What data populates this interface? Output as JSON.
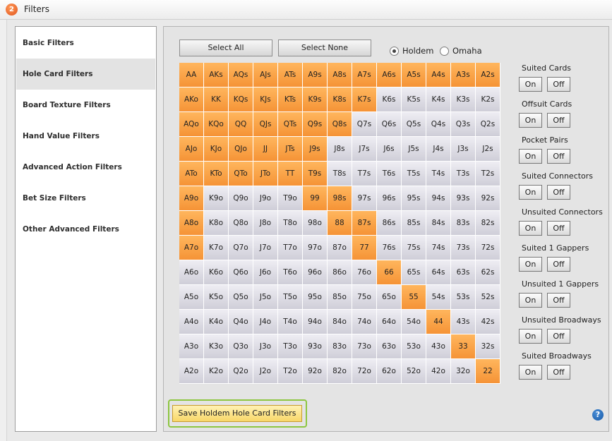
{
  "window": {
    "title": "Filters",
    "icon": "app-logo-icon"
  },
  "nav": {
    "items": [
      {
        "label": "Basic Filters"
      },
      {
        "label": "Hole Card Filters",
        "selected": true
      },
      {
        "label": "Board Texture Filters"
      },
      {
        "label": "Hand Value Filters"
      },
      {
        "label": "Advanced Action Filters"
      },
      {
        "label": "Bet Size Filters"
      },
      {
        "label": "Other Advanced Filters"
      }
    ]
  },
  "toolbar": {
    "select_all": "Select All",
    "select_none": "Select None",
    "game": {
      "options": [
        "Holdem",
        "Omaha"
      ],
      "selected": "Holdem"
    }
  },
  "grid": {
    "rows": [
      [
        "AA",
        "AKs",
        "AQs",
        "AJs",
        "ATs",
        "A9s",
        "A8s",
        "A7s",
        "A6s",
        "A5s",
        "A4s",
        "A3s",
        "A2s"
      ],
      [
        "AKo",
        "KK",
        "KQs",
        "KJs",
        "KTs",
        "K9s",
        "K8s",
        "K7s",
        "K6s",
        "K5s",
        "K4s",
        "K3s",
        "K2s"
      ],
      [
        "AQo",
        "KQo",
        "QQ",
        "QJs",
        "QTs",
        "Q9s",
        "Q8s",
        "Q7s",
        "Q6s",
        "Q5s",
        "Q4s",
        "Q3s",
        "Q2s"
      ],
      [
        "AJo",
        "KJo",
        "QJo",
        "JJ",
        "JTs",
        "J9s",
        "J8s",
        "J7s",
        "J6s",
        "J5s",
        "J4s",
        "J3s",
        "J2s"
      ],
      [
        "ATo",
        "KTo",
        "QTo",
        "JTo",
        "TT",
        "T9s",
        "T8s",
        "T7s",
        "T6s",
        "T5s",
        "T4s",
        "T3s",
        "T2s"
      ],
      [
        "A9o",
        "K9o",
        "Q9o",
        "J9o",
        "T9o",
        "99",
        "98s",
        "97s",
        "96s",
        "95s",
        "94s",
        "93s",
        "92s"
      ],
      [
        "A8o",
        "K8o",
        "Q8o",
        "J8o",
        "T8o",
        "98o",
        "88",
        "87s",
        "86s",
        "85s",
        "84s",
        "83s",
        "82s"
      ],
      [
        "A7o",
        "K7o",
        "Q7o",
        "J7o",
        "T7o",
        "97o",
        "87o",
        "77",
        "76s",
        "75s",
        "74s",
        "73s",
        "72s"
      ],
      [
        "A6o",
        "K6o",
        "Q6o",
        "J6o",
        "T6o",
        "96o",
        "86o",
        "76o",
        "66",
        "65s",
        "64s",
        "63s",
        "62s"
      ],
      [
        "A5o",
        "K5o",
        "Q5o",
        "J5o",
        "T5o",
        "95o",
        "85o",
        "75o",
        "65o",
        "55",
        "54s",
        "53s",
        "52s"
      ],
      [
        "A4o",
        "K4o",
        "Q4o",
        "J4o",
        "T4o",
        "94o",
        "84o",
        "74o",
        "64o",
        "54o",
        "44",
        "43s",
        "42s"
      ],
      [
        "A3o",
        "K3o",
        "Q3o",
        "J3o",
        "T3o",
        "93o",
        "83o",
        "73o",
        "63o",
        "53o",
        "43o",
        "33",
        "32s"
      ],
      [
        "A2o",
        "K2o",
        "Q2o",
        "J2o",
        "T2o",
        "92o",
        "82o",
        "72o",
        "62o",
        "52o",
        "42o",
        "32o",
        "22"
      ]
    ],
    "selected": [
      "AA",
      "AKs",
      "AQs",
      "AJs",
      "ATs",
      "A9s",
      "A8s",
      "A7s",
      "A6s",
      "A5s",
      "A4s",
      "A3s",
      "A2s",
      "AKo",
      "KK",
      "KQs",
      "KJs",
      "KTs",
      "K9s",
      "K8s",
      "K7s",
      "AQo",
      "KQo",
      "QQ",
      "QJs",
      "QTs",
      "Q9s",
      "Q8s",
      "AJo",
      "KJo",
      "QJo",
      "JJ",
      "JTs",
      "J9s",
      "ATo",
      "KTo",
      "QTo",
      "JTo",
      "TT",
      "T9s",
      "A9o",
      "99",
      "98s",
      "A8o",
      "88",
      "87s",
      "A7o",
      "77",
      "66",
      "55",
      "44",
      "33",
      "22"
    ],
    "selected_color": "#f59336",
    "unselected_color": "#dcdbe3"
  },
  "toggles": {
    "on_label": "On",
    "off_label": "Off",
    "groups": [
      {
        "label": "Suited Cards"
      },
      {
        "label": "Offsuit Cards"
      },
      {
        "label": "Pocket Pairs"
      },
      {
        "label": "Suited Connectors"
      },
      {
        "label": "Unsuited Connectors"
      },
      {
        "label": "Suited 1 Gappers"
      },
      {
        "label": "Unsuited 1 Gappers"
      },
      {
        "label": "Unsuited Broadways"
      },
      {
        "label": "Suited Broadways"
      }
    ]
  },
  "footer": {
    "save_label": "Save Holdem Hole Card Filters",
    "help_icon": "help-icon",
    "help_glyph": "?"
  }
}
